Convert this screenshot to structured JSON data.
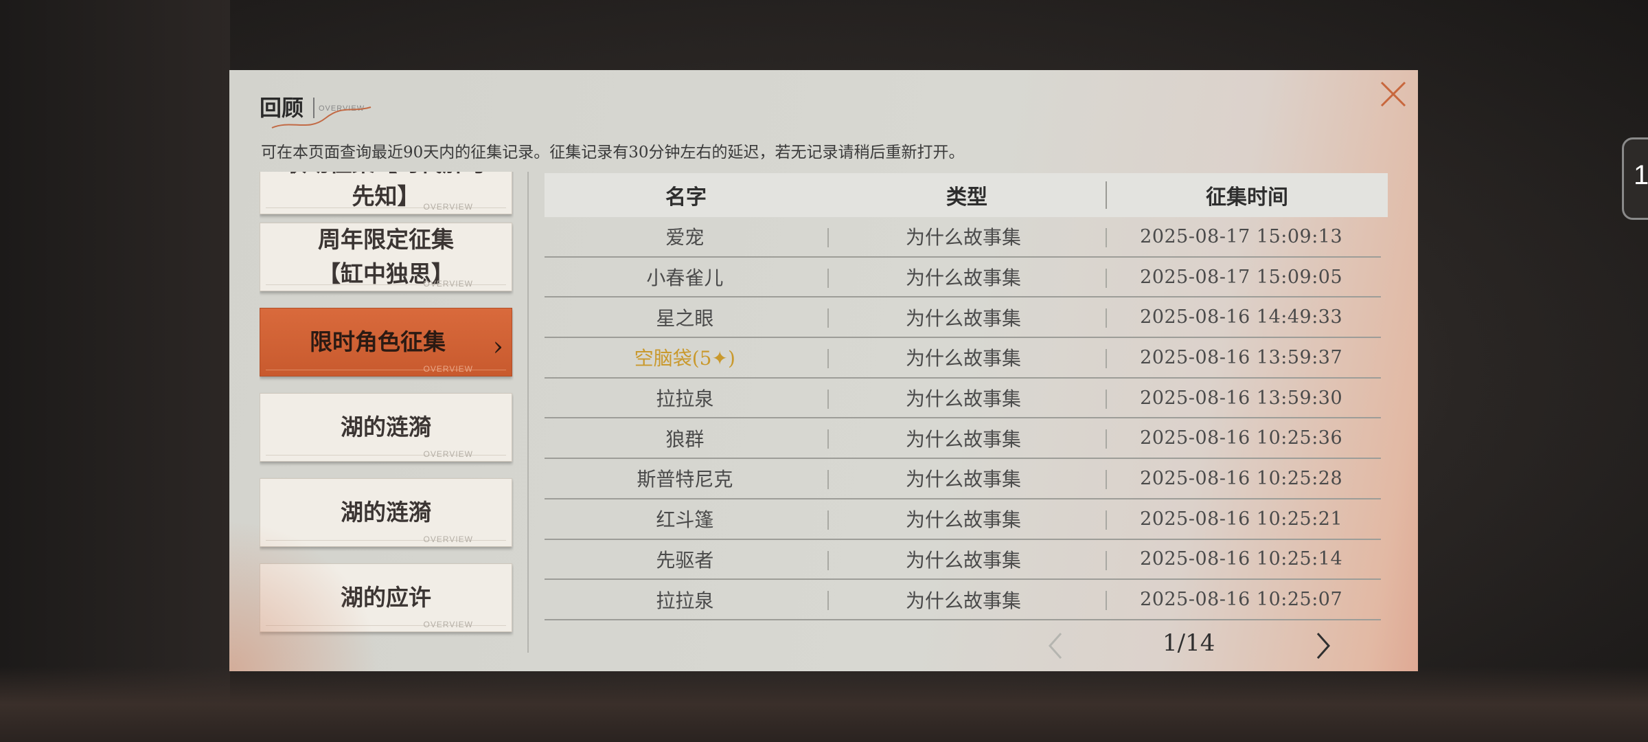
{
  "header": {
    "title": "回顾",
    "subtitle": "OVERVIEW",
    "notice": "可在本页面查询最近90天内的征集记录。征集记录有30分钟左右的延迟，若无记录请稍后重新打开。"
  },
  "side_widget": {
    "label": "1"
  },
  "sidebar": {
    "items": [
      {
        "label": "联动征集【时代肝号\n先知】",
        "tag": "OVERVIEW",
        "active": false
      },
      {
        "label": "周年限定征集\n【缸中独思】",
        "tag": "OVERVIEW",
        "active": false
      },
      {
        "label": "限时角色征集",
        "tag": "OVERVIEW",
        "active": true
      },
      {
        "label": "湖的涟漪",
        "tag": "OVERVIEW",
        "active": false
      },
      {
        "label": "湖的涟漪",
        "tag": "OVERVIEW",
        "active": false
      },
      {
        "label": "湖的应许",
        "tag": "OVERVIEW",
        "active": false
      }
    ]
  },
  "table": {
    "headers": {
      "name": "名字",
      "type": "类型",
      "time": "征集时间"
    },
    "rows": [
      {
        "name": "爱宠",
        "type": "为什么故事集",
        "time": "2025-08-17 15:09:13",
        "highlight": false
      },
      {
        "name": "小春雀儿",
        "type": "为什么故事集",
        "time": "2025-08-17 15:09:05",
        "highlight": false
      },
      {
        "name": "星之眼",
        "type": "为什么故事集",
        "time": "2025-08-16 14:49:33",
        "highlight": false
      },
      {
        "name": "空脑袋(5✦)",
        "type": "为什么故事集",
        "time": "2025-08-16 13:59:37",
        "highlight": true
      },
      {
        "name": "拉拉泉",
        "type": "为什么故事集",
        "time": "2025-08-16 13:59:30",
        "highlight": false
      },
      {
        "name": "狼群",
        "type": "为什么故事集",
        "time": "2025-08-16 10:25:36",
        "highlight": false
      },
      {
        "name": "斯普特尼克",
        "type": "为什么故事集",
        "time": "2025-08-16 10:25:28",
        "highlight": false
      },
      {
        "name": "红斗篷",
        "type": "为什么故事集",
        "time": "2025-08-16 10:25:21",
        "highlight": false
      },
      {
        "name": "先驱者",
        "type": "为什么故事集",
        "time": "2025-08-16 10:25:14",
        "highlight": false
      },
      {
        "name": "拉拉泉",
        "type": "为什么故事集",
        "time": "2025-08-16 10:25:07",
        "highlight": false
      }
    ]
  },
  "pager": {
    "text": "1/14"
  },
  "colors": {
    "accent": "#d0622f",
    "gold": "#c9992d",
    "close": "#c8673d"
  },
  "icons": {
    "close": "close-icon",
    "prev": "chevron-left-icon",
    "next": "chevron-right-icon",
    "chevron": "chevron-right-icon"
  }
}
